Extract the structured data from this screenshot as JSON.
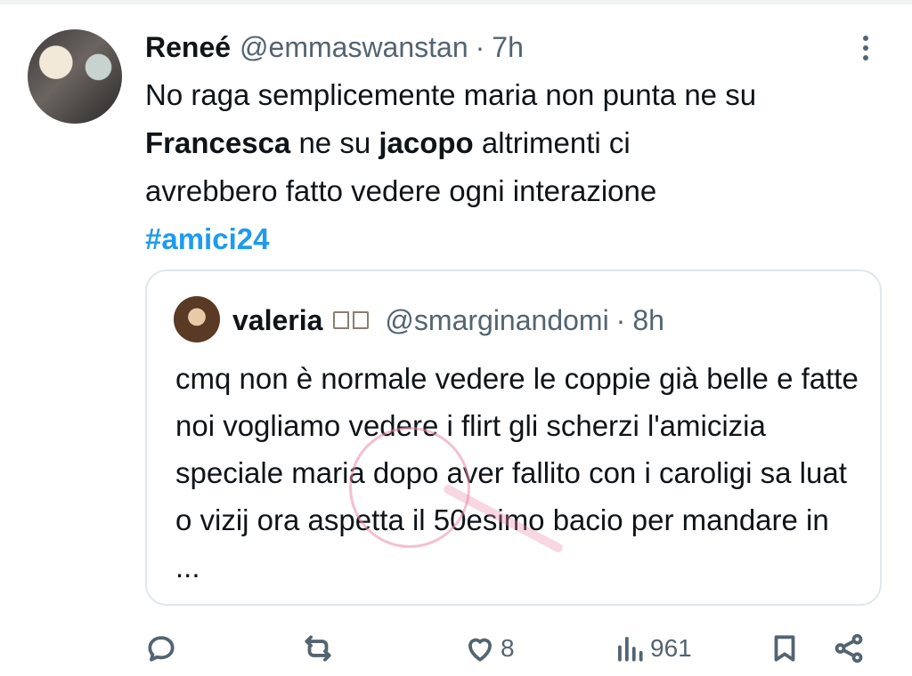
{
  "tweet": {
    "author_name": "Reneé",
    "author_handle": "@emmaswanstan",
    "separator": "·",
    "time": "7h",
    "text_line1": "No raga semplicemente maria non punta ne su",
    "text_bold1": "Francesca",
    "text_mid": " ne su ",
    "text_bold2": "jacopo",
    "text_line2_end": " altrimenti ci",
    "text_line3": "avrebbero fatto vedere ogni interazione",
    "hashtag": "#amici24"
  },
  "quote": {
    "author_name": "valeria",
    "author_handle": "@smarginandomi",
    "separator": "·",
    "time": "8h",
    "text": "cmq non è normale vedere le coppie già belle e fatte noi vogliamo vedere i flirt gli scherzi l'amicizia speciale maria dopo aver fallito con i caroligi sa luat o vizij ora aspetta il 50esimo bacio per mandare in ..."
  },
  "actions": {
    "likes": "8",
    "views": "961"
  },
  "icons": [
    "more-icon",
    "reply-icon",
    "retweet-icon",
    "like-icon",
    "views-icon",
    "bookmark-icon",
    "share-icon",
    "book-emoji-icon"
  ],
  "colors": {
    "text": "#0f1419",
    "muted": "#536471",
    "link": "#1d9bf0",
    "border": "#e1e8ed"
  }
}
